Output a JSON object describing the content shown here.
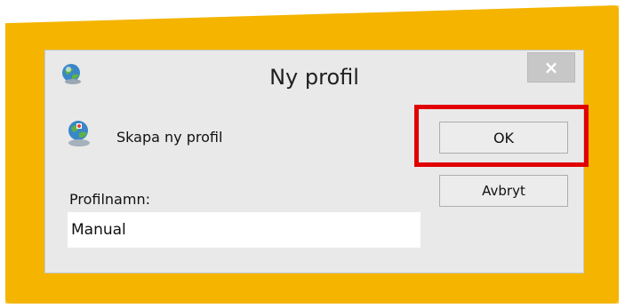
{
  "dialog": {
    "title": "Ny profil",
    "close_symbol": "×",
    "app_icon": "outlook-profile-icon",
    "heading": "Skapa ny profil",
    "heading_icon": "profile-globe-icon",
    "field_label": "Profilnamn:",
    "field_value": "Manual",
    "ok_label": "OK",
    "cancel_label": "Avbryt"
  },
  "colors": {
    "background_glow": "#f4b400",
    "highlight": "#e00000",
    "dialog_bg": "#e9e9e9"
  }
}
